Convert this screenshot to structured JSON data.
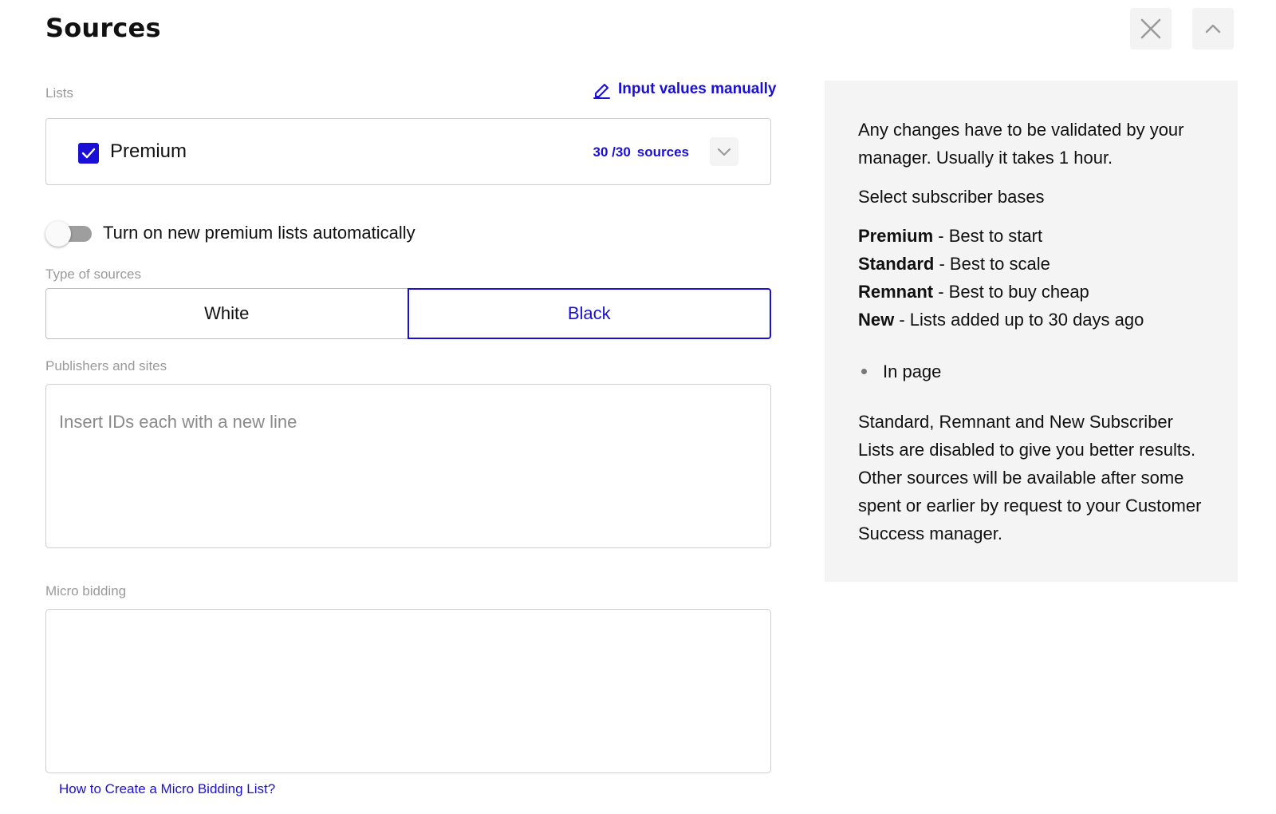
{
  "header": {
    "title": "Sources",
    "close_icon": "close-icon",
    "collapse_icon": "chevron-up-icon"
  },
  "lists": {
    "label": "Lists",
    "manual_link_label": "Input values manually",
    "manual_link_icon": "pencil-icon",
    "item": {
      "name": "Premium",
      "checked": true,
      "count": "30 /30",
      "count_label": "sources"
    }
  },
  "auto_toggle": {
    "label": "Turn on new premium lists automatically",
    "on": false
  },
  "type_of_sources": {
    "label": "Type of sources",
    "options": [
      "White",
      "Black"
    ],
    "selected": "Black"
  },
  "publishers": {
    "label": "Publishers and sites",
    "placeholder": "Insert IDs each with a new line",
    "value": ""
  },
  "micro_bidding": {
    "label": "Micro bidding",
    "value": "",
    "help_link": "How to Create a Micro Bidding List?"
  },
  "info": {
    "p1": "Any changes have to be validated by your manager. Usually it takes 1 hour.",
    "p2": "Select subscriber bases",
    "tiers": [
      {
        "name": "Premium",
        "desc": " - Best to start"
      },
      {
        "name": "Standard",
        "desc": " - Best to scale"
      },
      {
        "name": "Remnant",
        "desc": " - Best to buy cheap"
      },
      {
        "name": "New",
        "desc": " - Lists added up to 30 days ago"
      }
    ],
    "bullets": [
      "In page"
    ],
    "p3": "Standard, Remnant and New Subscriber Lists are disabled to give you better results. Other sources will be available after some spent or earlier by request to your Customer Success manager."
  },
  "colors": {
    "accent": "#1a0fd6",
    "label_gray": "#9a9a9a",
    "info_bg": "#f4f4f4"
  }
}
